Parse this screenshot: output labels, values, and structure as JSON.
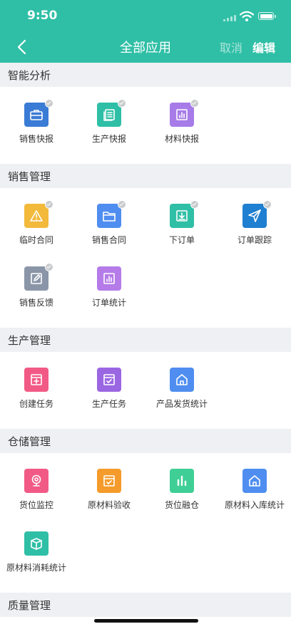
{
  "status": {
    "time": "9:50"
  },
  "nav": {
    "title": "全部应用",
    "cancel_label": "取消",
    "edit_label": "编辑"
  },
  "colors": {
    "header": "#2fbfa6",
    "section_bg": "#eef0f3"
  },
  "sections": [
    {
      "title": "智能分析",
      "items": [
        {
          "label": "销售快报",
          "icon": "briefcase-icon",
          "color": "#3a7bd5",
          "badge": true
        },
        {
          "label": "生产快报",
          "icon": "report-icon",
          "color": "#2fbfa6",
          "badge": true
        },
        {
          "label": "材料快报",
          "icon": "bar-chart-icon",
          "color": "#a77ce8",
          "badge": true
        }
      ]
    },
    {
      "title": "销售管理",
      "items": [
        {
          "label": "临时合同",
          "icon": "warning-icon",
          "color": "#f2b93b",
          "badge": true
        },
        {
          "label": "销售合同",
          "icon": "folder-icon",
          "color": "#4f8ef0",
          "badge": true
        },
        {
          "label": "下订单",
          "icon": "download-icon",
          "color": "#2fbfa6",
          "badge": true
        },
        {
          "label": "订单跟踪",
          "icon": "send-icon",
          "color": "#1f7fd1",
          "badge": true
        },
        {
          "label": "销售反馈",
          "icon": "edit-icon",
          "color": "#8a96a8",
          "badge": true
        },
        {
          "label": "订单统计",
          "icon": "bar-chart-icon",
          "color": "#b57be8",
          "badge": false
        }
      ]
    },
    {
      "title": "生产管理",
      "items": [
        {
          "label": "创建任务",
          "icon": "add-window-icon",
          "color": "#f25a86",
          "badge": false
        },
        {
          "label": "生产任务",
          "icon": "check-window-icon",
          "color": "#9b66e2",
          "badge": false
        },
        {
          "label": "产品发货统计",
          "icon": "house-icon",
          "color": "#4f8ef0",
          "badge": false
        }
      ]
    },
    {
      "title": "仓储管理",
      "items": [
        {
          "label": "货位监控",
          "icon": "webcam-icon",
          "color": "#f25a86",
          "badge": false
        },
        {
          "label": "原材料验收",
          "icon": "check-window-icon",
          "color": "#f59b2b",
          "badge": false
        },
        {
          "label": "货位融仓",
          "icon": "bars-icon",
          "color": "#3fcf96",
          "badge": false
        },
        {
          "label": "原材料入库统计",
          "icon": "house-icon",
          "color": "#4f8ef0",
          "badge": false
        },
        {
          "label": "原材料消耗统计",
          "icon": "box-icon",
          "color": "#2fbfa6",
          "badge": false
        }
      ]
    },
    {
      "title": "质量管理",
      "items": []
    }
  ]
}
